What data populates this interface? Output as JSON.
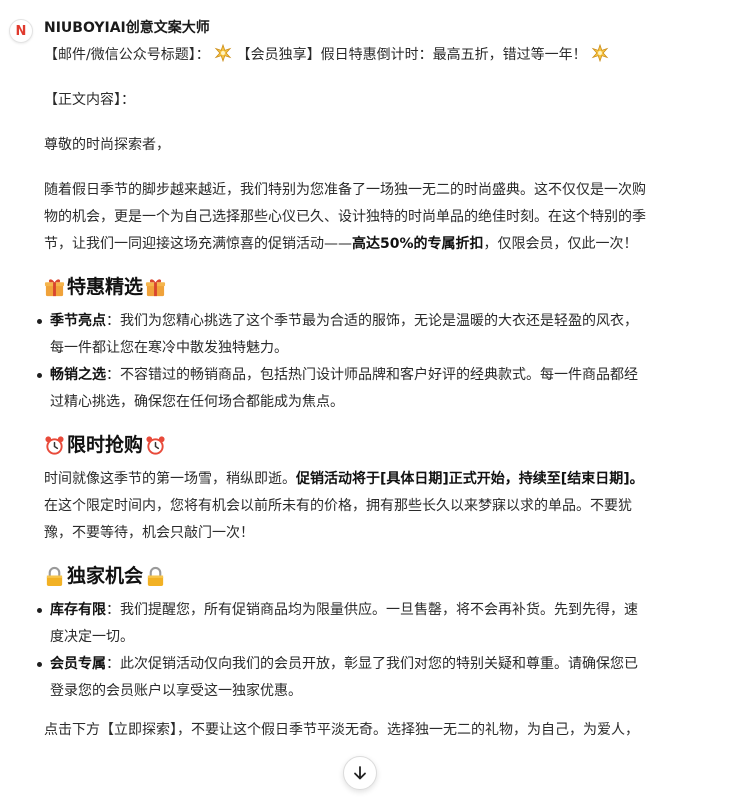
{
  "bot": {
    "avatar_letter": "N",
    "name": "NIUBOYIAI创意文案大师"
  },
  "message": {
    "title_prefix": "【邮件/微信公众号标题】：",
    "title_text": "【会员独享】假日特惠倒计时：最高五折，错过等一年！",
    "body_label": "【正文内容】：",
    "greeting": "尊敬的时尚探索者，",
    "intro_lines": [
      "随着假日季节的脚步越来越近，我们特别为您准备了一场独一无二的时尚盛典。这不仅仅是一次购",
      "物的机会，更是一个为自己选择那些心仪已久、设计独特的时尚单品的绝佳时刻。在这个特别的季"
    ],
    "intro_last_before": "节，让我们一同迎接这场充满惊喜的促销活动——",
    "intro_last_bold": "高达50%的专属折扣",
    "intro_last_after": "，仅限会员，仅此一次！",
    "sections": [
      {
        "title": "特惠精选",
        "icon": "gift-icon",
        "items": [
          {
            "label": "季节亮点",
            "line1": "：我们为您精心挑选了这个季节最为合适的服饰，无论是温暖的大衣还是轻盈的风衣，",
            "line2": "每一件都让您在寒冷中散发独特魅力。"
          },
          {
            "label": "畅销之选",
            "line1": "：不容错过的畅销商品，包括热门设计师品牌和客户好评的经典款式。每一件商品都经",
            "line2": "过精心挑选，确保您在任何场合都能成为焦点。"
          }
        ]
      },
      {
        "title": "限时抢购",
        "icon": "alarm-clock-icon",
        "para_line1_plain": "时间就像这季节的第一场雪，稍纵即逝。",
        "para_line1_bold": "促销活动将于[具体日期]正式开始，持续至[结束日期]。",
        "para_line2": "在这个限定时间内，您将有机会以前所未有的价格，拥有那些长久以来梦寐以求的单品。不要犹",
        "para_line3": "豫，不要等待，机会只敲门一次！"
      },
      {
        "title": "独家机会",
        "icon": "lock-icon",
        "items": [
          {
            "label": "库存有限",
            "line1": "：我们提醒您，所有促销商品均为限量供应。一旦售罄，将不会再补货。先到先得，速",
            "line2": "度决定一切。"
          },
          {
            "label": "会员专属",
            "line1": "：此次促销活动仅向我们的会员开放，彰显了我们对您的特别关疑和尊重。请确保您已",
            "line2": "登录您的会员账户以享受这一独家优惠。"
          }
        ]
      }
    ],
    "closing_line": "点击下方【立即探索】，不要让这个假日季节平淡无奇。选择独一无二的礼物，为自己，为爱人，"
  },
  "colors": {
    "avatar_red": "#e03a2e",
    "gift": "#f0a23a",
    "clock_red": "#e84a3a",
    "lock_gold": "#f2b124"
  }
}
